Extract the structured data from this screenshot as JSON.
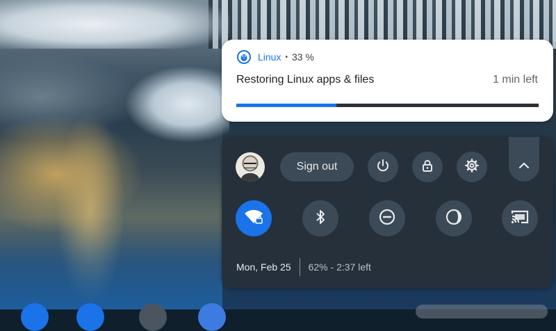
{
  "notification": {
    "app_name": "Linux",
    "separator": "•",
    "percent_text": "33 %",
    "message": "Restoring Linux apps & files",
    "time_left": "1 min left",
    "progress": 0.33,
    "icon": "linux-penguin-icon",
    "accent": "#1a73e8"
  },
  "quick_settings": {
    "sign_out_label": "Sign out",
    "top_buttons": [
      "power-icon",
      "lock-icon",
      "settings-gear-icon"
    ],
    "collapse_icon": "chevron-up-icon",
    "feature_toggles": [
      {
        "name": "wifi",
        "icon": "wifi-icon",
        "on": true
      },
      {
        "name": "bluetooth",
        "icon": "bluetooth-icon",
        "on": false
      },
      {
        "name": "do-not-disturb",
        "icon": "do-not-disturb-icon",
        "on": false
      },
      {
        "name": "night-light",
        "icon": "night-light-icon",
        "on": false
      },
      {
        "name": "cast",
        "icon": "cast-icon",
        "on": false
      }
    ],
    "date": "Mon, Feb 25",
    "battery": "62% - 2:37 left"
  },
  "colors": {
    "panel": "#26303a",
    "button": "#3c4a57",
    "active": "#1a73e8"
  }
}
